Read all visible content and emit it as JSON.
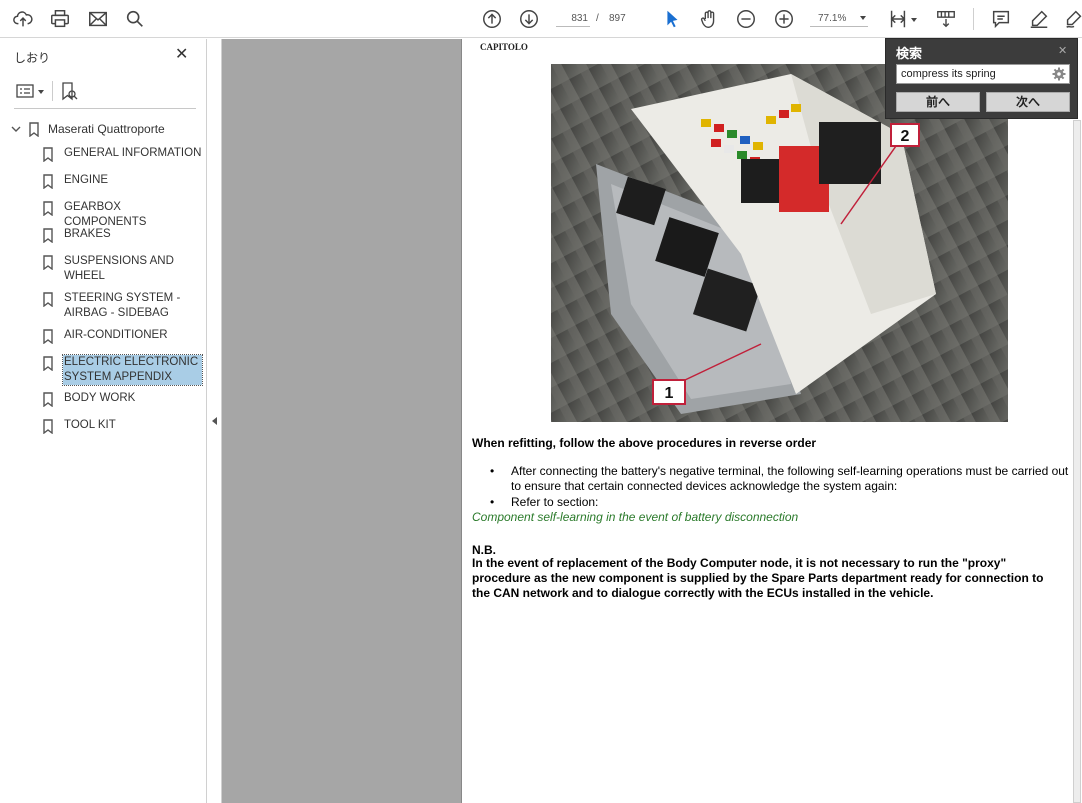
{
  "toolbar": {
    "current_page": "831",
    "page_separator": "/",
    "total_pages": "897",
    "zoom": "77.1%"
  },
  "sidebar": {
    "title": "しおり",
    "close_glyph": "✕",
    "root": {
      "label": "Maserati Quattroporte"
    },
    "items": [
      {
        "label": "GENERAL INFORMATION"
      },
      {
        "label": "ENGINE"
      },
      {
        "label": "GEARBOX COMPONENTS"
      },
      {
        "label": "BRAKES"
      },
      {
        "label": "SUSPENSIONS AND WHEEL"
      },
      {
        "label": "STEERING SYSTEM - AIRBAG - SIDEBAG"
      },
      {
        "label": "AIR-CONDITIONER"
      },
      {
        "label": "ELECTRIC ELECTRONIC SYSTEM APPENDIX"
      },
      {
        "label": "BODY WORK"
      },
      {
        "label": "TOOL KIT"
      }
    ]
  },
  "document": {
    "chapter": "CAPITOLO",
    "photo_labels": {
      "one": "1",
      "two": "2"
    },
    "heading": "When refitting, follow the above procedures in reverse order",
    "bullet1": "After connecting the battery's negative terminal, the following self-learning operations must be carried out to ensure that certain connected devices acknowledge the system again:",
    "bullet2": "Refer to section:",
    "bullet_glyph": "•",
    "link": "Component self-learning in the event of battery disconnection",
    "nb_title": "N.B.",
    "nb_text": "In the event of replacement of the Body Computer node, it is not necessary to run the \"proxy\" procedure as the new component is supplied by the Spare Parts department ready for connection to the CAN network and to dialogue correctly with the ECUs installed in the vehicle."
  },
  "search": {
    "title": "検索",
    "close_glyph": "✕",
    "query": "compress its spring",
    "prev_label": "前へ",
    "next_label": "次へ"
  },
  "colors": {
    "link_green": "#2a7a2a",
    "selection": "#a9cde6",
    "pointer_blue": "#1a6fd1",
    "doc_background": "#a6a6a6"
  },
  "icons": [
    "upload-icon",
    "print-icon",
    "mail-icon",
    "search-icon",
    "page-up-icon",
    "page-down-icon",
    "select-cursor-icon",
    "hand-tool-icon",
    "zoom-out-icon",
    "zoom-in-icon",
    "fit-page-icon",
    "read-mode-icon",
    "comment-icon",
    "highlight-pen-icon",
    "sign-icon",
    "bookmark-icon",
    "gear-icon"
  ]
}
